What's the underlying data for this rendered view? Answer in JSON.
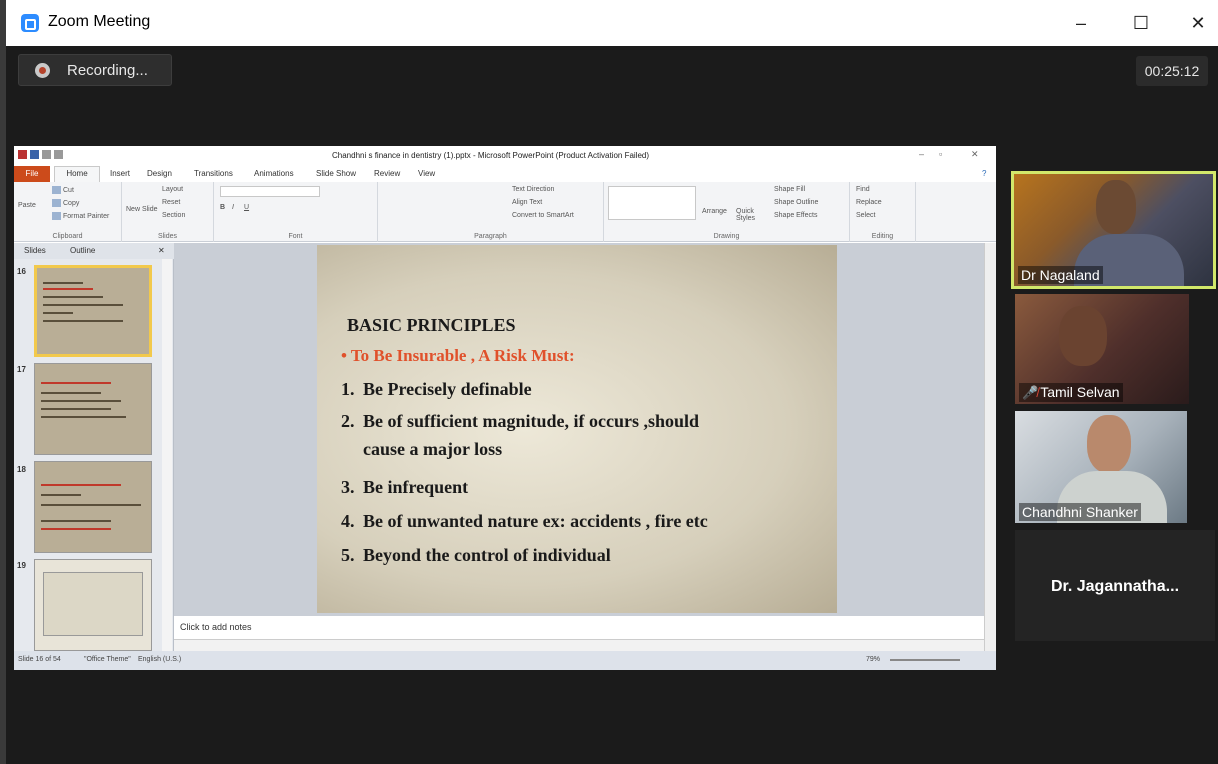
{
  "window": {
    "title": "Zoom Meeting",
    "minimize": "–",
    "maximize": "☐",
    "close": "✕"
  },
  "meeting": {
    "recording_label": "Recording...",
    "timer": "00:25:12"
  },
  "powerpoint": {
    "doc_title": "Chandhni s finance in dentistry (1).pptx - Microsoft PowerPoint (Product Activation Failed)",
    "tabs": [
      "File",
      "Home",
      "Insert",
      "Design",
      "Transitions",
      "Animations",
      "Slide Show",
      "Review",
      "View"
    ],
    "ribbon_groups": {
      "clipboard": {
        "name": "Clipboard",
        "cut": "Cut",
        "copy": "Copy",
        "paste": "Paste",
        "format_painter": "Format Painter"
      },
      "slides": {
        "name": "Slides",
        "new_slide": "New Slide",
        "layout": "Layout",
        "reset": "Reset",
        "section": "Section"
      },
      "font": {
        "name": "Font"
      },
      "paragraph": {
        "name": "Paragraph",
        "text_direction": "Text Direction",
        "align_text": "Align Text",
        "smartart": "Convert to SmartArt"
      },
      "drawing": {
        "name": "Drawing",
        "arrange": "Arrange",
        "quick_styles": "Quick Styles",
        "shape_fill": "Shape Fill",
        "shape_outline": "Shape Outline",
        "shape_effects": "Shape Effects"
      },
      "editing": {
        "name": "Editing",
        "find": "Find",
        "replace": "Replace",
        "select": "Select"
      }
    },
    "panel_tabs": {
      "slides": "Slides",
      "outline": "Outline"
    },
    "thumbnails": [
      "16",
      "17",
      "18",
      "19"
    ],
    "slide": {
      "heading": "BASIC PRINCIPLES",
      "bullet": "• To Be Insurable , A Risk Must:",
      "items": [
        {
          "n": "1.",
          "text": "Be Precisely definable"
        },
        {
          "n": "2.",
          "text": "Be of sufficient magnitude, if occurs ,should"
        },
        {
          "n": "",
          "text": "cause a major loss"
        },
        {
          "n": "3.",
          "text": "Be infrequent"
        },
        {
          "n": "4.",
          "text": "Be of unwanted nature ex: accidents , fire etc"
        },
        {
          "n": "5.",
          "text": "Beyond the control of individual"
        }
      ]
    },
    "notes_placeholder": "Click to add notes",
    "status": {
      "slide_count": "Slide 16 of 54",
      "theme": "\"Office Theme\"",
      "language": "English (U.S.)",
      "zoom": "79%"
    }
  },
  "participants": [
    {
      "name": "Dr Nagaland"
    },
    {
      "name": "Tamil Selvan"
    },
    {
      "name": "Chandhni Shanker"
    },
    {
      "name": "Dr. Jagannatha..."
    }
  ],
  "colors": {
    "zoom_blue": "#2d8cff",
    "active_speaker": "#d2e86a",
    "ppt_file_tab": "#cc4b1b",
    "slide_bullet": "#e0512b"
  }
}
